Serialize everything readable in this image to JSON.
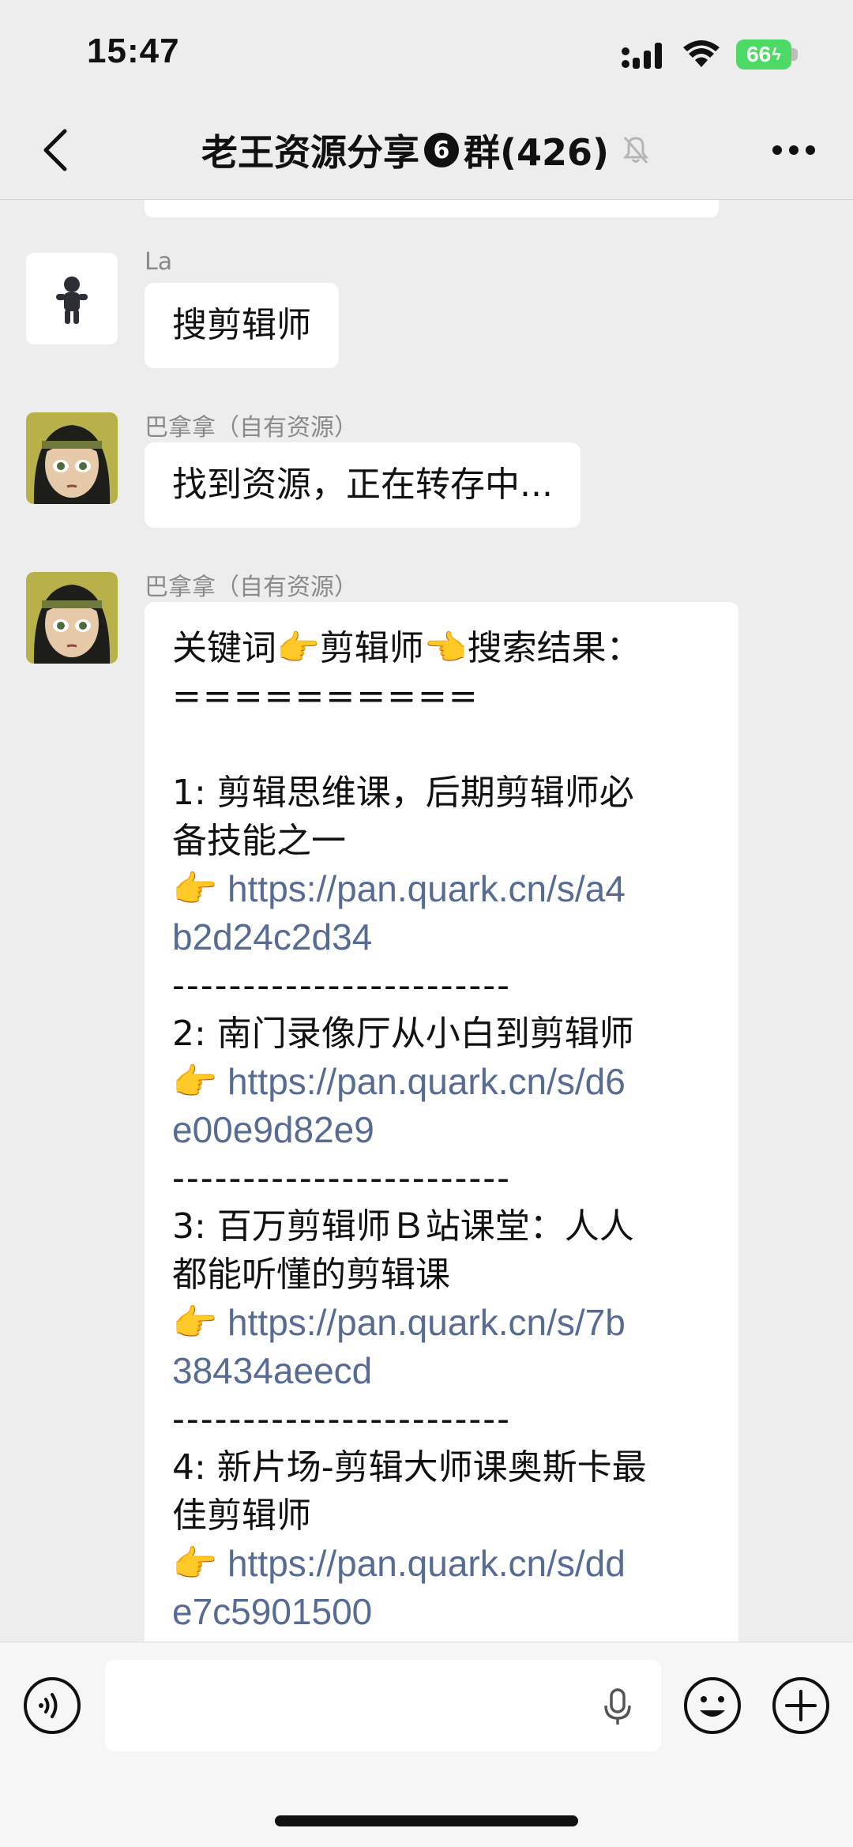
{
  "status_bar": {
    "time": "15:47",
    "battery": "66"
  },
  "nav": {
    "title_prefix": "老王资源分享",
    "title_badge": "6",
    "title_suffix": "群(426)"
  },
  "messages": [
    {
      "sender": "La",
      "text": "搜剪辑师"
    },
    {
      "sender": "巴拿拿（自有资源）",
      "text": "找到资源，正在转存中..."
    },
    {
      "sender": "巴拿拿（自有资源）",
      "lines": [
        "关键词👉剪辑师👈搜索结果：",
        "==========",
        "",
        "1: 剪辑思维课，后期剪辑师必",
        "备技能之一",
        "👉 https://pan.quark.cn/s/a4",
        "b2d24c2d34",
        "------------------------",
        "2: 南门录像厅从小白到剪辑师",
        "👉 https://pan.quark.cn/s/d6",
        "e00e9d82e9",
        "------------------------",
        "3: 百万剪辑师Ｂ站课堂：人人",
        "都能听懂的剪辑课",
        "👉 https://pan.quark.cn/s/7b",
        "38434aeecd",
        "------------------------",
        "4: 新片场-剪辑大师课奥斯卡最",
        "佳剪辑师",
        "👉 https://pan.quark.cn/s/dd",
        "e7c5901500"
      ]
    }
  ],
  "icons": {
    "back": "chevron-left-icon",
    "muted": "bell-slash-icon",
    "more": "more-dots-icon",
    "voice": "voice-icon",
    "mic": "mic-icon",
    "emoji": "emoji-icon",
    "plus": "plus-icon"
  },
  "colors": {
    "background": "#ededed",
    "bubble": "#ffffff",
    "link": "#576b95",
    "battery": "#4cd964"
  }
}
